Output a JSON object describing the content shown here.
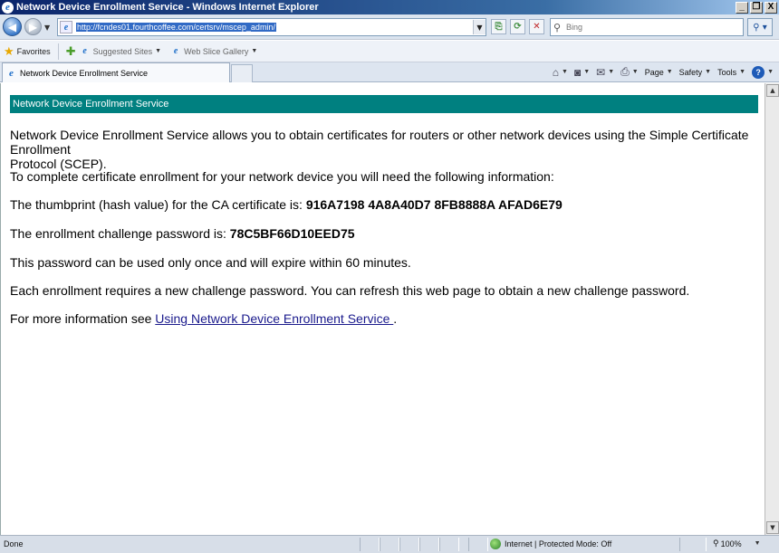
{
  "window": {
    "title": "Network Device Enrollment Service - Windows Internet Explorer",
    "minimize": "_",
    "restore": "❐",
    "close": "X"
  },
  "nav": {
    "url": "http://fcndes01.fourthcoffee.com/certsrv/mscep_admin/",
    "search_placeholder": "Bing"
  },
  "favorites": {
    "label": "Favorites",
    "links": [
      "Suggested Sites",
      "Web Slice Gallery"
    ]
  },
  "tab": {
    "title": "Network Device Enrollment Service"
  },
  "commands": {
    "page": "Page",
    "safety": "Safety",
    "tools": "Tools"
  },
  "content": {
    "header": "Network Device Enrollment Service",
    "intro_line1": "Network Device Enrollment Service allows you to obtain certificates for routers or other network devices using the Simple Certificate Enrollment",
    "intro_line2": "Protocol (SCEP).",
    "need_info": "To complete certificate enrollment for your network device you will need the following information:",
    "thumbprint_label": "The thumbprint (hash value) for the CA certificate is: ",
    "thumbprint_value": "916A7198 4A8A40D7 8FB8888A AFAD6E79",
    "password_label": "The enrollment challenge password is: ",
    "password_value": "78C5BF66D10EED75",
    "password_note": "This password can be used only once and will expire within 60 minutes.",
    "refresh_note": "Each enrollment requires a new challenge password. You can refresh this web page to obtain a new challenge password.",
    "more_info_prefix": "For more information see ",
    "more_info_link": "Using Network Device Enrollment Service ",
    "more_info_suffix": "."
  },
  "status": {
    "text": "Done",
    "zone": "Internet | Protected Mode: Off",
    "zoom": "100%"
  }
}
